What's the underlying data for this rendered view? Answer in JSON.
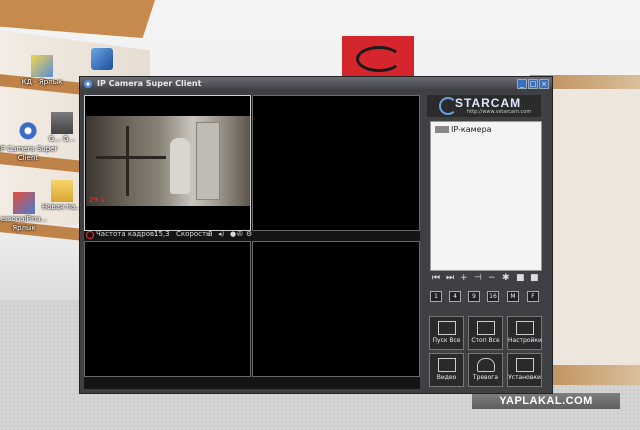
{
  "desktop": {
    "icons": [
      {
        "label": "КД - Ярлык",
        "name": "desktop-icon-kd-shortcut"
      },
      {
        "label": "",
        "name": "desktop-icon-network"
      },
      {
        "label": "IP Camera Super Client",
        "name": "desktop-icon-ip-camera"
      },
      {
        "label": "G... G...",
        "name": "desktop-icon-g"
      },
      {
        "label": "ersonalFina... Ярлык",
        "name": "desktop-icon-personal-finance"
      },
      {
        "label": "Новая па...",
        "name": "desktop-icon-new-folder"
      }
    ],
    "watermark": "YAPLAKAL.COM"
  },
  "window": {
    "title": "IP Camera Super Client",
    "buttons": {
      "minimize": "_",
      "maximize": "□",
      "close": "×"
    }
  },
  "video": {
    "timestamp": "29.1",
    "status": {
      "fps_label": "Частота кадров:",
      "fps_value": "15,3",
      "speed_label": "Скорость:",
      "speed_value": "8"
    }
  },
  "sidebar": {
    "logo_text": "STARCAM",
    "logo_url": "http://www.vstarcam.com",
    "tree_root": "IP-камера",
    "ptz_controls": [
      "⏮",
      "⏭",
      "+",
      "⊣",
      "−",
      "✱",
      "■",
      "■"
    ],
    "layout_buttons": [
      "1",
      "4",
      "9",
      "16",
      "M",
      "F"
    ],
    "function_buttons": [
      {
        "label": "Пуск Все",
        "name": "start-all-button"
      },
      {
        "label": "Стоп Все",
        "name": "stop-all-button"
      },
      {
        "label": "Настройки",
        "name": "settings-button"
      },
      {
        "label": "Видео",
        "name": "video-button"
      },
      {
        "label": "Тревога",
        "name": "alarm-button"
      },
      {
        "label": "Установки",
        "name": "setup-button"
      }
    ]
  },
  "colors": {
    "accent": "#3a6fbf",
    "record_red": "#ff2a2a",
    "window_bg": "#3e4043"
  }
}
